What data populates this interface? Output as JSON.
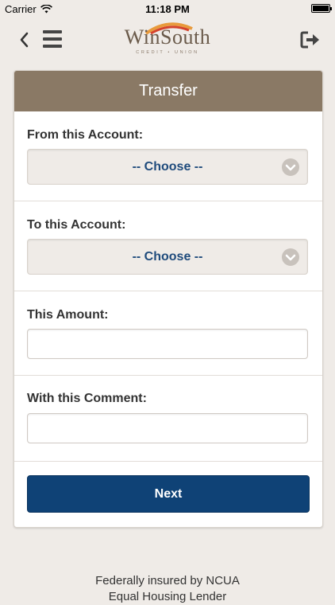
{
  "status_bar": {
    "carrier": "Carrier",
    "time": "11:18 PM"
  },
  "header": {
    "logo_text": "WinSouth",
    "logo_subtext": "CREDIT • UNION"
  },
  "form": {
    "title": "Transfer",
    "from_label": "From this Account:",
    "from_value": "-- Choose --",
    "to_label": "To this Account:",
    "to_value": "-- Choose --",
    "amount_label": "This Amount:",
    "amount_value": "",
    "comment_label": "With this Comment:",
    "comment_value": "",
    "next_label": "Next"
  },
  "footer": {
    "line1": "Federally insured by NCUA",
    "line2": "Equal Housing Lender"
  },
  "colors": {
    "header": "#8a7965",
    "button": "#0f4276",
    "select_text": "#1f4b7c",
    "background": "#efebe7"
  },
  "icons": {
    "back": "chevron-left-icon",
    "menu": "hamburger-menu-icon",
    "logout": "logout-icon",
    "select": "chevron-down-icon",
    "wifi": "wifi-icon",
    "battery": "battery-icon"
  }
}
